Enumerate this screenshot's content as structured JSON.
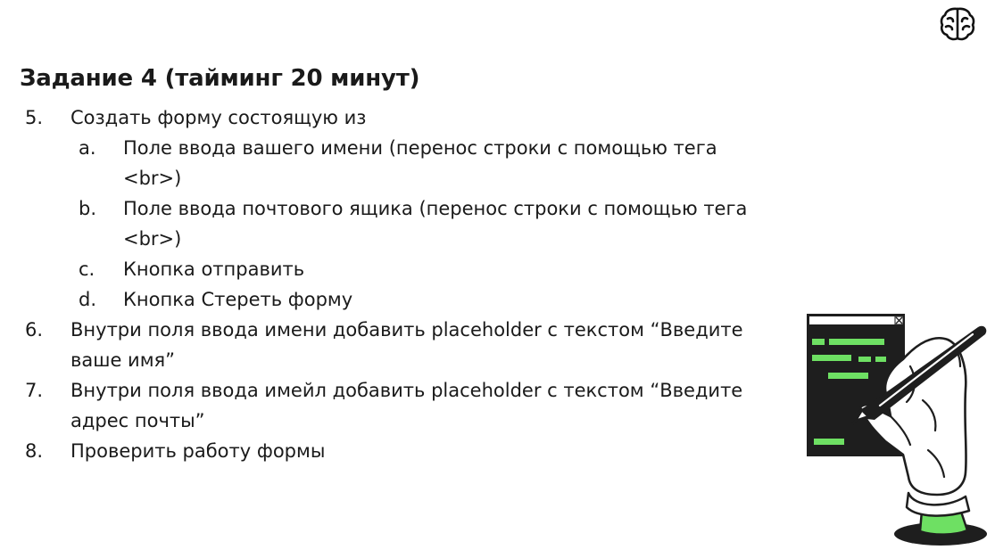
{
  "slide": {
    "logo_icon": "brain-icon",
    "title": "Задание 4 (тайминг 20 минут)",
    "items": [
      {
        "num": "5.",
        "level": 1,
        "lines": [
          "Создать форму состоящую из"
        ]
      },
      {
        "num": "a.",
        "level": 2,
        "lines": [
          "Поле ввода вашего имени (перенос строки с помощью тега",
          "<br>)"
        ]
      },
      {
        "num": "b.",
        "level": 2,
        "lines": [
          "Поле ввода почтового ящика (перенос строки с помощью тега",
          "<br>)"
        ]
      },
      {
        "num": "c.",
        "level": 2,
        "lines": [
          "Кнопка отправить"
        ]
      },
      {
        "num": "d.",
        "level": 2,
        "lines": [
          "Кнопка Стереть форму"
        ]
      },
      {
        "num": "6.",
        "level": 1,
        "lines": [
          "Внутри поля ввода имени добавить placeholder с текстом “Введите",
          "ваше имя”"
        ]
      },
      {
        "num": "7.",
        "level": 1,
        "lines": [
          "Внутри поля ввода имейл добавить placeholder с текстом “Введите",
          "адрес почты”"
        ]
      },
      {
        "num": "8.",
        "level": 1,
        "lines": [
          "Проверить работу формы"
        ]
      }
    ],
    "illustration_icon": "hand-writing-code-illustration",
    "colors": {
      "accent": "#6ee063",
      "dark": "#1e1e1e",
      "text": "#1a1a1a"
    }
  }
}
